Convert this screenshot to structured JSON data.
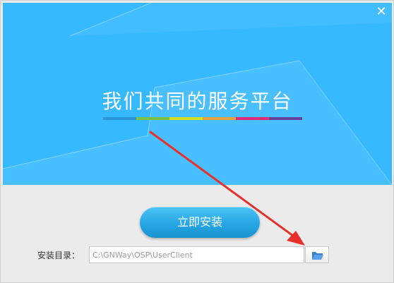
{
  "banner": {
    "title": "我们共同的服务平台",
    "background_color": "#37b9ff",
    "color_bar": [
      "#2a95d8",
      "#7cc242",
      "#d6df23",
      "#e8a23a",
      "#e5297c",
      "#6a3d9a"
    ]
  },
  "window": {
    "close_glyph": "✕"
  },
  "install": {
    "button_label": "立即安装"
  },
  "directory": {
    "label": "安装目录：",
    "value": "C:\\GNWay\\OSP\\UserClient",
    "browse_icon": "folder-open-icon"
  },
  "annotation": {
    "arrow_color": "#e8302a"
  }
}
